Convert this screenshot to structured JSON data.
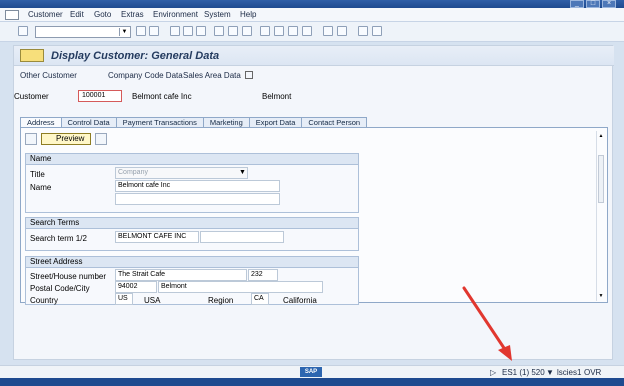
{
  "menu": [
    "Customer",
    "Edit",
    "Goto",
    "Extras",
    "Environment",
    "System",
    "Help"
  ],
  "page": {
    "title": "Display Customer: General Data"
  },
  "subToolbar": {
    "other_customer": "Other Customer",
    "company_code_data": "Company Code Data",
    "sales_area_data": "Sales Area Data"
  },
  "customer": {
    "label": "Customer",
    "number": "100001",
    "name": "Belmont cafe Inc",
    "city": "Belmont"
  },
  "tabs": [
    "Address",
    "Control Data",
    "Payment Transactions",
    "Marketing",
    "Export Data",
    "Contact Person"
  ],
  "panel": {
    "preview_label": "Preview"
  },
  "groups": {
    "name": {
      "header": "Name",
      "title_label": "Title",
      "title_value": "Company",
      "name_label": "Name",
      "name_value": "Belmont cafe Inc"
    },
    "search_terms": {
      "header": "Search Terms",
      "label": "Search term 1/2",
      "term1": "BELMONT CAFE INC",
      "term2": ""
    },
    "street_address": {
      "header": "Street Address",
      "street_label": "Street/House number",
      "street": "The Strait Cafe",
      "house": "232",
      "postal_label": "Postal Code/City",
      "postal": "94002",
      "city": "Belmont",
      "country_label": "Country",
      "country_code": "US",
      "country_name": "USA",
      "region_label": "Region",
      "region_code": "CA",
      "region_name": "California"
    }
  },
  "status": {
    "logo": "SAP",
    "system": "ES1 (1) 520",
    "server": "lscies1",
    "mode": "OVR"
  }
}
